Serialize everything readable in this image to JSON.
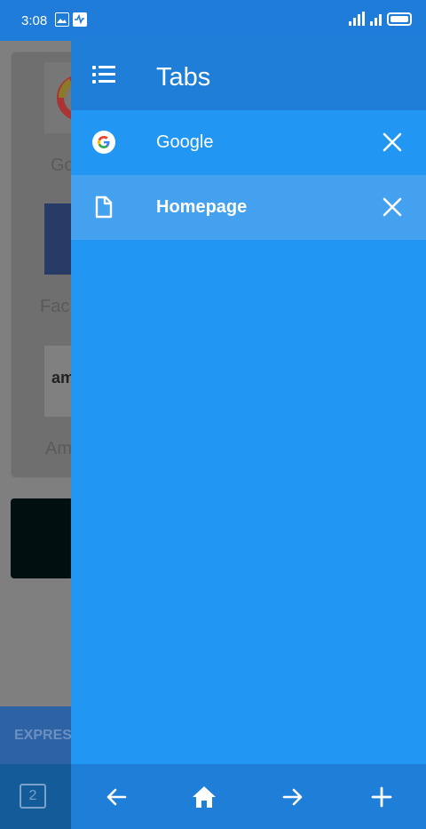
{
  "status_bar": {
    "time": "3:08"
  },
  "background": {
    "labels": [
      "Go",
      "Fac",
      "Am"
    ],
    "amazon_logo_text": "am",
    "express_label": "EXPRES",
    "tab_count": "2"
  },
  "drawer": {
    "title": "Tabs",
    "tabs": [
      {
        "label": "Google",
        "icon": "google-icon",
        "active": false
      },
      {
        "label": "Homepage",
        "icon": "document-icon",
        "active": true
      }
    ]
  },
  "bottom_nav": {
    "items": [
      "back-arrow-icon",
      "home-icon",
      "forward-arrow-icon",
      "plus-icon"
    ]
  },
  "colors": {
    "drawer_bg": "#2196f3",
    "header_bg": "#1e7ed8",
    "active_tab_bg": "#43a1f0"
  }
}
